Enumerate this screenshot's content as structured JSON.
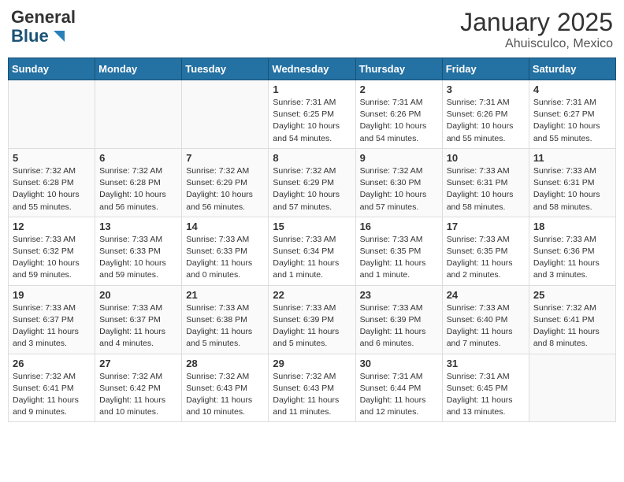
{
  "logo": {
    "general": "General",
    "blue": "Blue"
  },
  "title": "January 2025",
  "location": "Ahuisculco, Mexico",
  "days_of_week": [
    "Sunday",
    "Monday",
    "Tuesday",
    "Wednesday",
    "Thursday",
    "Friday",
    "Saturday"
  ],
  "weeks": [
    [
      {
        "day": "",
        "info": ""
      },
      {
        "day": "",
        "info": ""
      },
      {
        "day": "",
        "info": ""
      },
      {
        "day": "1",
        "info": "Sunrise: 7:31 AM\nSunset: 6:25 PM\nDaylight: 10 hours\nand 54 minutes."
      },
      {
        "day": "2",
        "info": "Sunrise: 7:31 AM\nSunset: 6:26 PM\nDaylight: 10 hours\nand 54 minutes."
      },
      {
        "day": "3",
        "info": "Sunrise: 7:31 AM\nSunset: 6:26 PM\nDaylight: 10 hours\nand 55 minutes."
      },
      {
        "day": "4",
        "info": "Sunrise: 7:31 AM\nSunset: 6:27 PM\nDaylight: 10 hours\nand 55 minutes."
      }
    ],
    [
      {
        "day": "5",
        "info": "Sunrise: 7:32 AM\nSunset: 6:28 PM\nDaylight: 10 hours\nand 55 minutes."
      },
      {
        "day": "6",
        "info": "Sunrise: 7:32 AM\nSunset: 6:28 PM\nDaylight: 10 hours\nand 56 minutes."
      },
      {
        "day": "7",
        "info": "Sunrise: 7:32 AM\nSunset: 6:29 PM\nDaylight: 10 hours\nand 56 minutes."
      },
      {
        "day": "8",
        "info": "Sunrise: 7:32 AM\nSunset: 6:29 PM\nDaylight: 10 hours\nand 57 minutes."
      },
      {
        "day": "9",
        "info": "Sunrise: 7:32 AM\nSunset: 6:30 PM\nDaylight: 10 hours\nand 57 minutes."
      },
      {
        "day": "10",
        "info": "Sunrise: 7:33 AM\nSunset: 6:31 PM\nDaylight: 10 hours\nand 58 minutes."
      },
      {
        "day": "11",
        "info": "Sunrise: 7:33 AM\nSunset: 6:31 PM\nDaylight: 10 hours\nand 58 minutes."
      }
    ],
    [
      {
        "day": "12",
        "info": "Sunrise: 7:33 AM\nSunset: 6:32 PM\nDaylight: 10 hours\nand 59 minutes."
      },
      {
        "day": "13",
        "info": "Sunrise: 7:33 AM\nSunset: 6:33 PM\nDaylight: 10 hours\nand 59 minutes."
      },
      {
        "day": "14",
        "info": "Sunrise: 7:33 AM\nSunset: 6:33 PM\nDaylight: 11 hours\nand 0 minutes."
      },
      {
        "day": "15",
        "info": "Sunrise: 7:33 AM\nSunset: 6:34 PM\nDaylight: 11 hours\nand 1 minute."
      },
      {
        "day": "16",
        "info": "Sunrise: 7:33 AM\nSunset: 6:35 PM\nDaylight: 11 hours\nand 1 minute."
      },
      {
        "day": "17",
        "info": "Sunrise: 7:33 AM\nSunset: 6:35 PM\nDaylight: 11 hours\nand 2 minutes."
      },
      {
        "day": "18",
        "info": "Sunrise: 7:33 AM\nSunset: 6:36 PM\nDaylight: 11 hours\nand 3 minutes."
      }
    ],
    [
      {
        "day": "19",
        "info": "Sunrise: 7:33 AM\nSunset: 6:37 PM\nDaylight: 11 hours\nand 3 minutes."
      },
      {
        "day": "20",
        "info": "Sunrise: 7:33 AM\nSunset: 6:37 PM\nDaylight: 11 hours\nand 4 minutes."
      },
      {
        "day": "21",
        "info": "Sunrise: 7:33 AM\nSunset: 6:38 PM\nDaylight: 11 hours\nand 5 minutes."
      },
      {
        "day": "22",
        "info": "Sunrise: 7:33 AM\nSunset: 6:39 PM\nDaylight: 11 hours\nand 5 minutes."
      },
      {
        "day": "23",
        "info": "Sunrise: 7:33 AM\nSunset: 6:39 PM\nDaylight: 11 hours\nand 6 minutes."
      },
      {
        "day": "24",
        "info": "Sunrise: 7:33 AM\nSunset: 6:40 PM\nDaylight: 11 hours\nand 7 minutes."
      },
      {
        "day": "25",
        "info": "Sunrise: 7:32 AM\nSunset: 6:41 PM\nDaylight: 11 hours\nand 8 minutes."
      }
    ],
    [
      {
        "day": "26",
        "info": "Sunrise: 7:32 AM\nSunset: 6:41 PM\nDaylight: 11 hours\nand 9 minutes."
      },
      {
        "day": "27",
        "info": "Sunrise: 7:32 AM\nSunset: 6:42 PM\nDaylight: 11 hours\nand 10 minutes."
      },
      {
        "day": "28",
        "info": "Sunrise: 7:32 AM\nSunset: 6:43 PM\nDaylight: 11 hours\nand 10 minutes."
      },
      {
        "day": "29",
        "info": "Sunrise: 7:32 AM\nSunset: 6:43 PM\nDaylight: 11 hours\nand 11 minutes."
      },
      {
        "day": "30",
        "info": "Sunrise: 7:31 AM\nSunset: 6:44 PM\nDaylight: 11 hours\nand 12 minutes."
      },
      {
        "day": "31",
        "info": "Sunrise: 7:31 AM\nSunset: 6:45 PM\nDaylight: 11 hours\nand 13 minutes."
      },
      {
        "day": "",
        "info": ""
      }
    ]
  ]
}
